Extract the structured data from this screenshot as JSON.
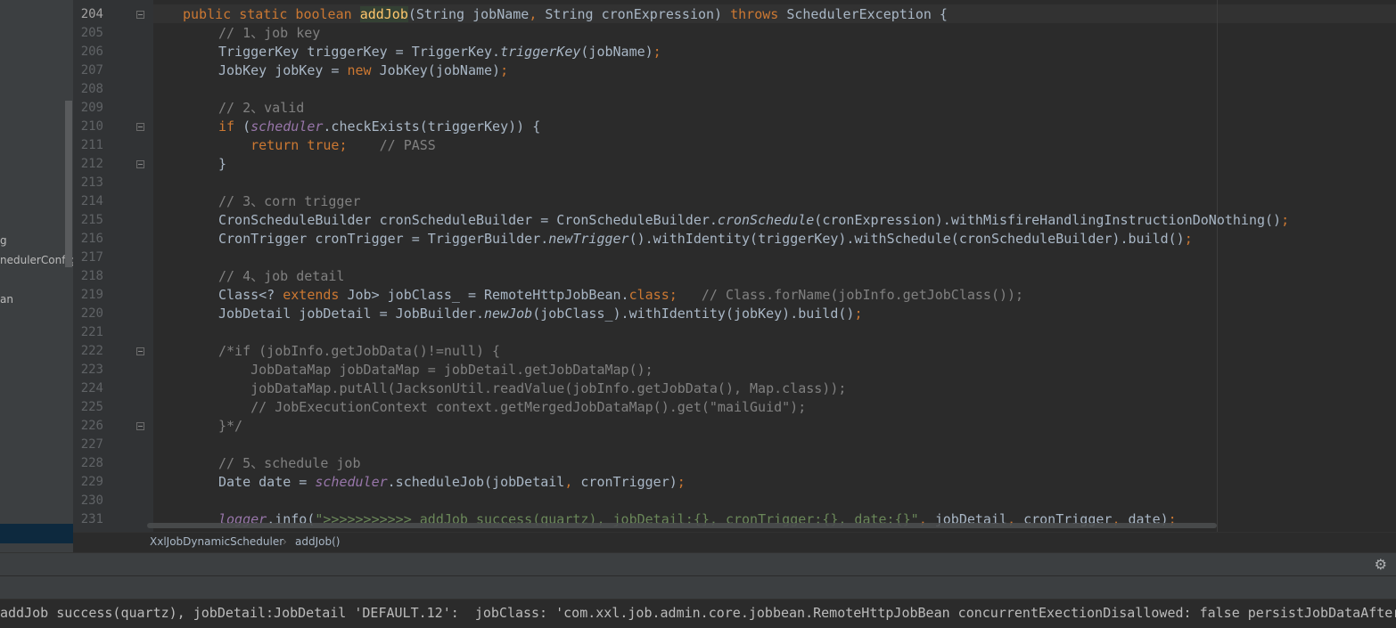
{
  "sidebar": {
    "tree_fragments": [
      "g",
      "nedulerConfig",
      "an"
    ]
  },
  "editor": {
    "current_line": "204",
    "lines": [
      {
        "no": "204",
        "segs": [
          {
            "t": "public static boolean ",
            "c": "kw"
          },
          {
            "t": "addJob",
            "c": "fnhl"
          },
          {
            "t": "(String jobName",
            "c": ""
          },
          {
            "t": ", ",
            "c": "kw"
          },
          {
            "t": "String cronExpression) ",
            "c": ""
          },
          {
            "t": "throws ",
            "c": "kw"
          },
          {
            "t": "SchedulerException {",
            "c": ""
          }
        ]
      },
      {
        "no": "205",
        "segs": [
          {
            "t": "// 1、job key",
            "c": "cm"
          }
        ]
      },
      {
        "no": "206",
        "segs": [
          {
            "t": "TriggerKey triggerKey = TriggerKey.",
            "c": ""
          },
          {
            "t": "triggerKey",
            "c": "it"
          },
          {
            "t": "(jobName)",
            "c": ""
          },
          {
            "t": ";",
            "c": "kw"
          }
        ]
      },
      {
        "no": "207",
        "segs": [
          {
            "t": "JobKey jobKey = ",
            "c": ""
          },
          {
            "t": "new ",
            "c": "kw"
          },
          {
            "t": "JobKey(jobName)",
            "c": ""
          },
          {
            "t": ";",
            "c": "kw"
          }
        ]
      },
      {
        "no": "208",
        "segs": []
      },
      {
        "no": "209",
        "segs": [
          {
            "t": "// 2、valid",
            "c": "cm"
          }
        ]
      },
      {
        "no": "210",
        "segs": [
          {
            "t": "if ",
            "c": "kw"
          },
          {
            "t": "(",
            "c": ""
          },
          {
            "t": "scheduler",
            "c": "fld"
          },
          {
            "t": ".checkExists(triggerKey)) {",
            "c": ""
          }
        ]
      },
      {
        "no": "211",
        "segs": [
          {
            "t": "    return true;",
            "c": "kw"
          },
          {
            "t": "    // PASS",
            "c": "cm"
          }
        ]
      },
      {
        "no": "212",
        "segs": [
          {
            "t": "}",
            "c": ""
          }
        ]
      },
      {
        "no": "213",
        "segs": []
      },
      {
        "no": "214",
        "segs": [
          {
            "t": "// 3、corn trigger",
            "c": "cm"
          }
        ]
      },
      {
        "no": "215",
        "segs": [
          {
            "t": "CronScheduleBuilder cronScheduleBuilder = CronScheduleBuilder.",
            "c": ""
          },
          {
            "t": "cronSchedule",
            "c": "it"
          },
          {
            "t": "(cronExpression).withMisfireHandlingInstructionDoNothing()",
            "c": ""
          },
          {
            "t": ";",
            "c": "kw"
          }
        ]
      },
      {
        "no": "216",
        "segs": [
          {
            "t": "CronTrigger cronTrigger = TriggerBuilder.",
            "c": ""
          },
          {
            "t": "newTrigger",
            "c": "it"
          },
          {
            "t": "().withIdentity(triggerKey).withSchedule(cronScheduleBuilder).build()",
            "c": ""
          },
          {
            "t": ";",
            "c": "kw"
          }
        ]
      },
      {
        "no": "217",
        "segs": []
      },
      {
        "no": "218",
        "segs": [
          {
            "t": "// 4、job detail",
            "c": "cm"
          }
        ]
      },
      {
        "no": "219",
        "segs": [
          {
            "t": "Class<? ",
            "c": ""
          },
          {
            "t": "extends ",
            "c": "kw"
          },
          {
            "t": "Job> jobClass_ = RemoteHttpJobBean.",
            "c": ""
          },
          {
            "t": "class;",
            "c": "kw"
          },
          {
            "t": "   // Class.forName(jobInfo.getJobClass());",
            "c": "cm"
          }
        ]
      },
      {
        "no": "220",
        "segs": [
          {
            "t": "JobDetail jobDetail = JobBuilder.",
            "c": ""
          },
          {
            "t": "newJob",
            "c": "it"
          },
          {
            "t": "(jobClass_).withIdentity(jobKey).build()",
            "c": ""
          },
          {
            "t": ";",
            "c": "kw"
          }
        ]
      },
      {
        "no": "221",
        "segs": []
      },
      {
        "no": "222",
        "segs": [
          {
            "t": "/*if (jobInfo.getJobData()!=null) {",
            "c": "cm"
          }
        ]
      },
      {
        "no": "223",
        "segs": [
          {
            "t": "    JobDataMap jobDataMap = jobDetail.getJobDataMap();",
            "c": "cm"
          }
        ]
      },
      {
        "no": "224",
        "segs": [
          {
            "t": "    jobDataMap.putAll(JacksonUtil.readValue(jobInfo.getJobData(), Map.class));",
            "c": "cm"
          }
        ]
      },
      {
        "no": "225",
        "segs": [
          {
            "t": "    // JobExecutionContext context.getMergedJobDataMap().get(\"mailGuid\");",
            "c": "cm"
          }
        ]
      },
      {
        "no": "226",
        "segs": [
          {
            "t": "}*/",
            "c": "cm"
          }
        ]
      },
      {
        "no": "227",
        "segs": []
      },
      {
        "no": "228",
        "segs": [
          {
            "t": "// 5、schedule job",
            "c": "cm"
          }
        ]
      },
      {
        "no": "229",
        "segs": [
          {
            "t": "Date date = ",
            "c": ""
          },
          {
            "t": "scheduler",
            "c": "fld"
          },
          {
            "t": ".scheduleJob(jobDetail",
            "c": ""
          },
          {
            "t": ", ",
            "c": "kw"
          },
          {
            "t": "cronTrigger)",
            "c": ""
          },
          {
            "t": ";",
            "c": "kw"
          }
        ]
      },
      {
        "no": "230",
        "segs": []
      },
      {
        "no": "231",
        "segs": [
          {
            "t": "logger",
            "c": "fld"
          },
          {
            "t": ".info(",
            "c": ""
          },
          {
            "t": "\">>>>>>>>>>> addJob success(quartz), jobDetail:{}, cronTrigger:{}, date:{}\"",
            "c": "str"
          },
          {
            "t": ", ",
            "c": "kw"
          },
          {
            "t": "jobDetail",
            "c": ""
          },
          {
            "t": ", ",
            "c": "kw"
          },
          {
            "t": "cronTrigger",
            "c": ""
          },
          {
            "t": ", ",
            "c": "kw"
          },
          {
            "t": "date)",
            "c": ""
          },
          {
            "t": ";",
            "c": "kw"
          }
        ]
      }
    ]
  },
  "breadcrumb": {
    "class_name": "XxlJobDynamicScheduler",
    "separator": "›",
    "method": "addJob()"
  },
  "run_panel": {
    "settings_icon": "⚙",
    "console_line": "addJob success(quartz), jobDetail:JobDetail 'DEFAULT.12':  jobClass: 'com.xxl.job.admin.core.jobbean.RemoteHttpJobBean concurrentExectionDisallowed: false persistJobDataAfterExecution: false isDurable: false requestsRecovers: false"
  },
  "colors": {
    "keyword": "#cc7832",
    "method": "#ffc66d",
    "comment": "#808080",
    "field": "#9876aa",
    "string": "#6a8759",
    "text": "#a9b7c6",
    "background": "#2b2b2b"
  }
}
